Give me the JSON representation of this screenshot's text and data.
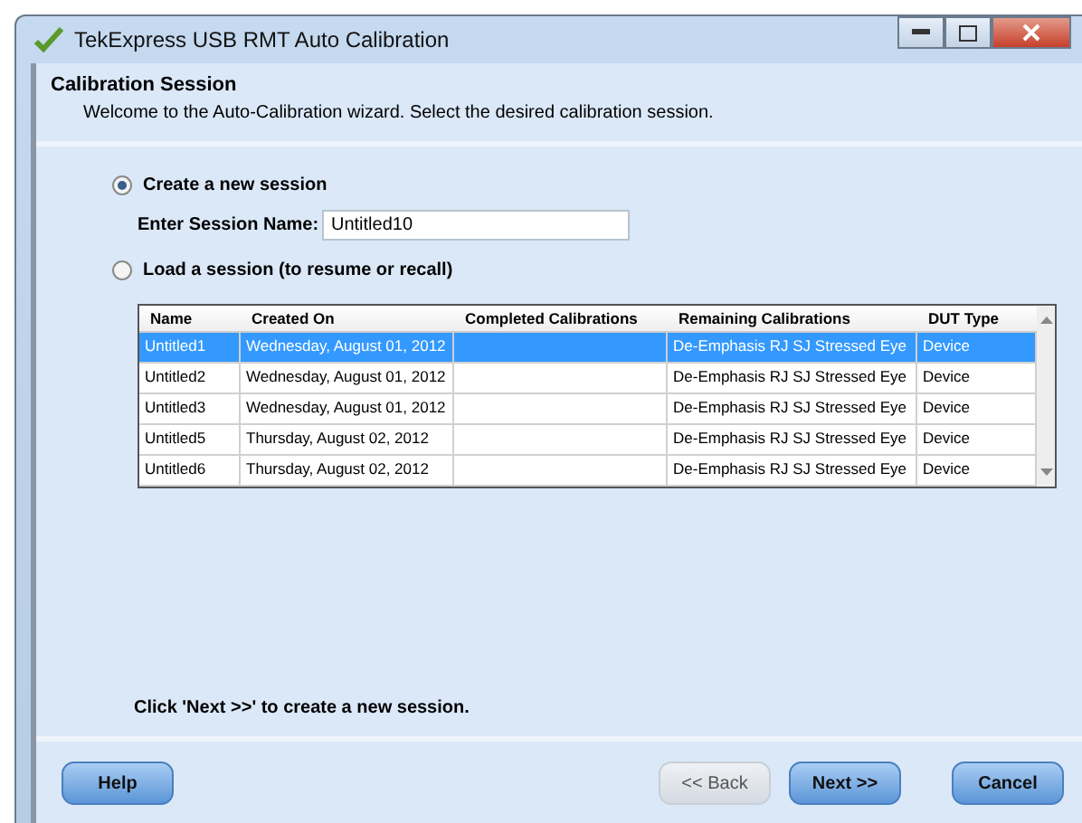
{
  "window": {
    "title": "TekExpress USB RMT Auto Calibration"
  },
  "header": {
    "title": "Calibration Session",
    "subtitle": "Welcome to the Auto-Calibration wizard. Select the desired calibration session."
  },
  "options": [
    {
      "label": "Create a new session",
      "selected": true
    },
    {
      "label": "Load a session (to resume or recall)",
      "selected": false
    }
  ],
  "session_name": {
    "label": "Enter Session Name:",
    "value": "Untitled10"
  },
  "table": {
    "columns": [
      "Name",
      "Created On",
      "Completed Calibrations",
      "Remaining Calibrations",
      "DUT Type"
    ],
    "rows": [
      {
        "cells": [
          "Untitled1",
          "Wednesday, August 01, 2012",
          "",
          "De-Emphasis RJ SJ Stressed Eye",
          "Device"
        ],
        "selected": true
      },
      {
        "cells": [
          "Untitled2",
          "Wednesday, August 01, 2012",
          "",
          "De-Emphasis RJ SJ Stressed Eye",
          "Device"
        ],
        "selected": false
      },
      {
        "cells": [
          "Untitled3",
          "Wednesday, August 01, 2012",
          "",
          "De-Emphasis RJ SJ Stressed Eye",
          "Device"
        ],
        "selected": false
      },
      {
        "cells": [
          "Untitled5",
          "Thursday, August 02, 2012",
          "",
          "De-Emphasis RJ SJ Stressed Eye",
          "Device"
        ],
        "selected": false
      },
      {
        "cells": [
          "Untitled6",
          "Thursday, August 02, 2012",
          "",
          "De-Emphasis RJ SJ Stressed Eye",
          "Device"
        ],
        "selected": false
      }
    ]
  },
  "hint": "Click 'Next >>' to create a new session.",
  "buttons": [
    {
      "label": "Help",
      "disabled": false
    },
    {
      "label": "<< Back",
      "disabled": true
    },
    {
      "label": "Next >>",
      "disabled": false
    },
    {
      "label": "Cancel",
      "disabled": false
    }
  ]
}
